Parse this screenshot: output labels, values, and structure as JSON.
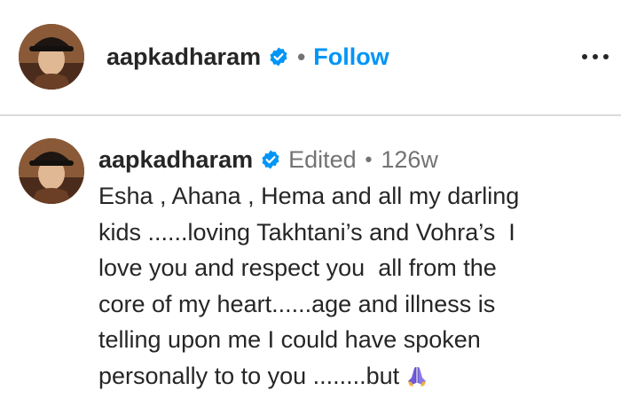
{
  "post_header": {
    "username": "aapkadharam",
    "separator": "•",
    "follow_label": "Follow",
    "more_icon": "more-horizontal-icon",
    "verified_icon": "verified-badge-icon"
  },
  "comment": {
    "username": "aapkadharam",
    "edited_label": "Edited",
    "separator": "•",
    "timestamp": "126w",
    "caption_lines": [
      "Esha , Ahana , Hema and all my darling",
      "kids ......loving Takhtani’s and Vohra’s  I",
      "love you and respect you  all from the",
      "core of my heart......age and illness is",
      "telling upon me I could have spoken",
      "personally to to you ........but"
    ],
    "emoji_icon": "folded-hands-icon"
  },
  "colors": {
    "link_blue": "#0095f6",
    "verified_blue": "#0095f6",
    "text": "#262626",
    "muted": "#737373",
    "divider": "#dbdbdb"
  }
}
